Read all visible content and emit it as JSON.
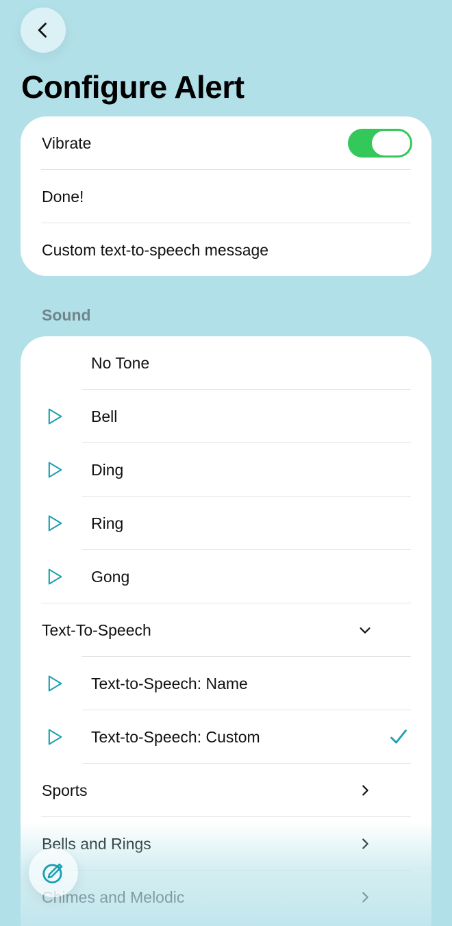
{
  "page": {
    "title": "Configure Alert"
  },
  "settings": {
    "vibrate_label": "Vibrate",
    "vibrate_on": true,
    "done_label": "Done!",
    "custom_message_label": "Custom text-to-speech message"
  },
  "sound": {
    "section_label": "Sound",
    "items": [
      {
        "label": "No Tone",
        "icon": ""
      },
      {
        "label": "Bell",
        "icon": "play-icon"
      },
      {
        "label": "Ding",
        "icon": "play-icon"
      },
      {
        "label": "Ring",
        "icon": "play-icon"
      },
      {
        "label": "Gong",
        "icon": "play-icon"
      },
      {
        "label": "Text-To-Speech",
        "icon": "chevron-down-icon"
      },
      {
        "label": "Text-to-Speech: Name",
        "icon": "play-icon"
      },
      {
        "label": "Text-to-Speech: Custom",
        "icon": "play-icon",
        "selected": true
      },
      {
        "label": "Sports",
        "icon": "chevron-right-icon"
      },
      {
        "label": "Bells and Rings",
        "icon": "chevron-right-icon"
      },
      {
        "label": "Chimes and Melodic",
        "icon": "chevron-right-icon"
      }
    ]
  },
  "colors": {
    "background": "#b2e0e8",
    "accent": "#1aa0b0",
    "toggle_on": "#34c759"
  }
}
